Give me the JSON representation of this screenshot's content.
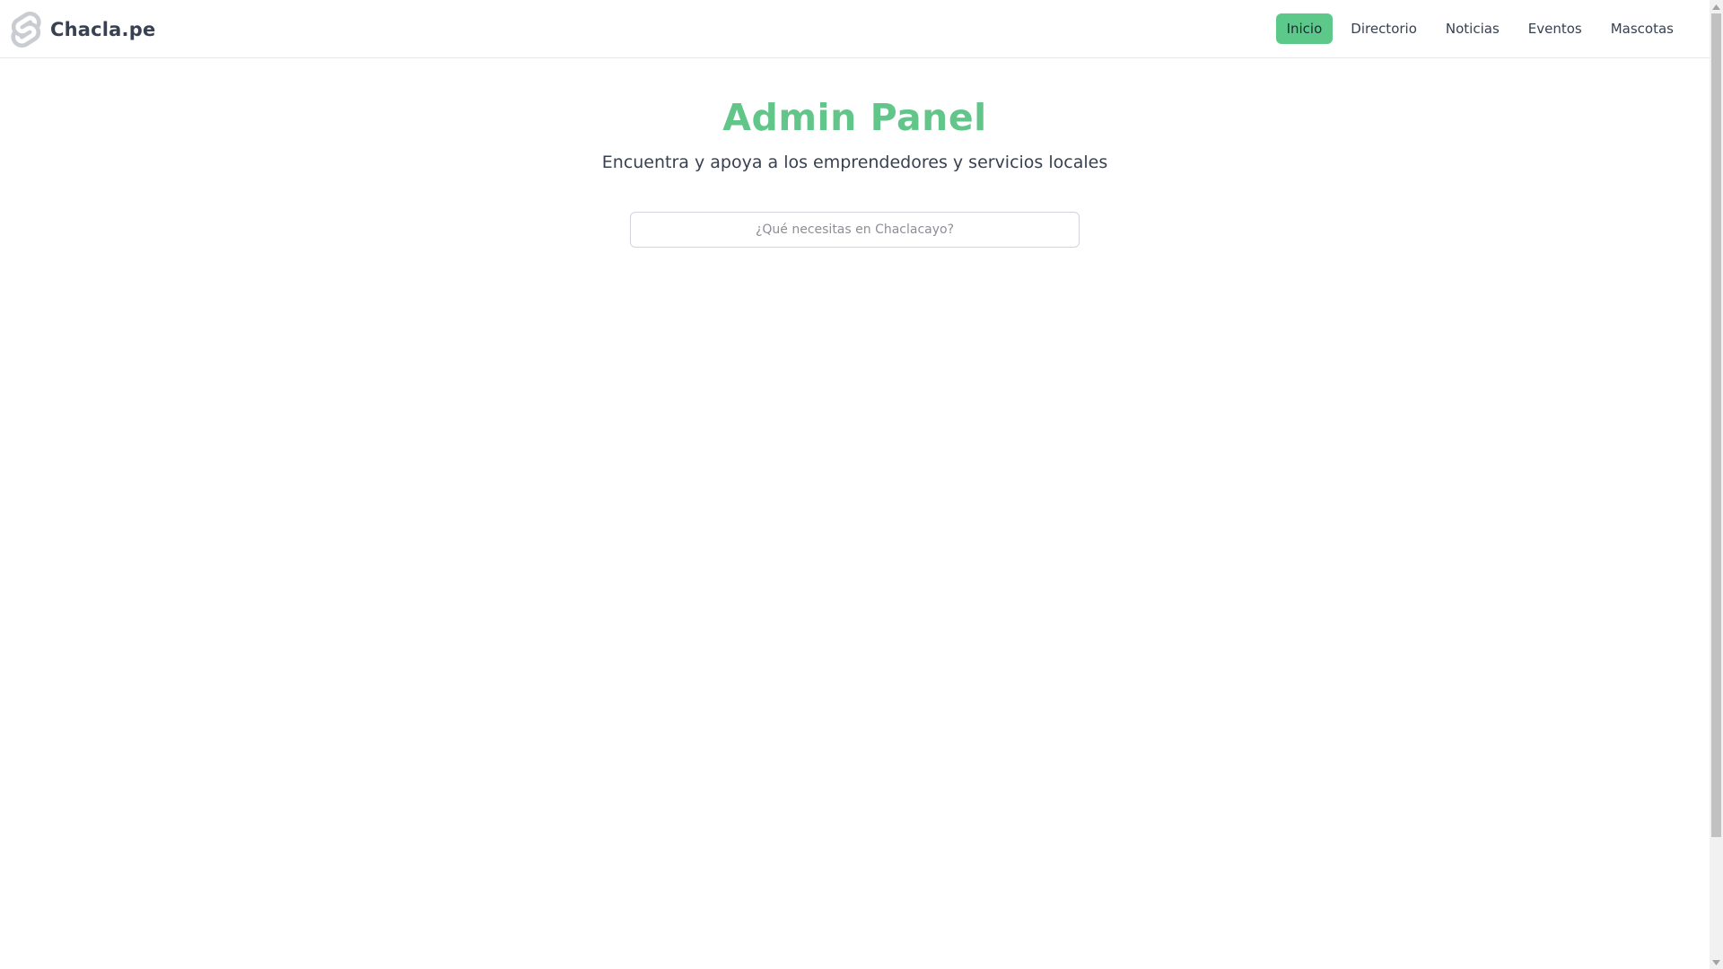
{
  "header": {
    "brand_name": "Chacla.pe",
    "logo_icon": "svelte-logo-icon",
    "nav": [
      {
        "label": "Inicio",
        "active": true
      },
      {
        "label": "Directorio",
        "active": false
      },
      {
        "label": "Noticias",
        "active": false
      },
      {
        "label": "Eventos",
        "active": false
      },
      {
        "label": "Mascotas",
        "active": false
      }
    ]
  },
  "hero": {
    "title": "Admin Panel",
    "subtitle": "Encuentra y apoya a los emprendedores y servicios locales"
  },
  "search": {
    "value": "",
    "placeholder": "¿Qué necesitas en Chaclacayo?"
  },
  "colors": {
    "accent": "#62c58a",
    "active_nav_bg": "#5cc98a",
    "text": "#374151",
    "border": "#d1d5db"
  }
}
